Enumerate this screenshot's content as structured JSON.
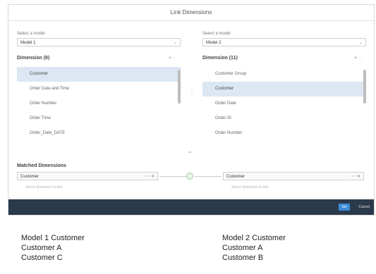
{
  "dialog": {
    "title": "Link Dimensions",
    "left": {
      "select_label": "Select a model",
      "model": "Model 1",
      "dimensions_header": "Dimension  (8)",
      "items": [
        "Customer",
        "Order Date and Time",
        "Order Number",
        "Order Time",
        "Order_Date_DATE"
      ],
      "selected_index": 0
    },
    "right": {
      "select_label": "Select a model",
      "model": "Model 2",
      "dimensions_header": "Dimension  (11)",
      "items": [
        "Customer Group",
        "Customer",
        "Order Date",
        "Order ID",
        "Order Number"
      ],
      "selected_index": 1
    },
    "matched": {
      "title": "Matched Dimensions",
      "left_value": "Customer",
      "right_value": "Customer",
      "left_hint": "Select dimension to link",
      "right_hint": "Select dimension to link"
    },
    "footer": {
      "ok": "Set",
      "cancel": "Cancel"
    }
  },
  "tables": {
    "left": {
      "header": "Model 1 Customer",
      "rows": [
        "Customer A",
        "Customer C"
      ]
    },
    "right": {
      "header": "Model 2 Customer",
      "rows": [
        "Customer A",
        "Customer B"
      ]
    }
  }
}
